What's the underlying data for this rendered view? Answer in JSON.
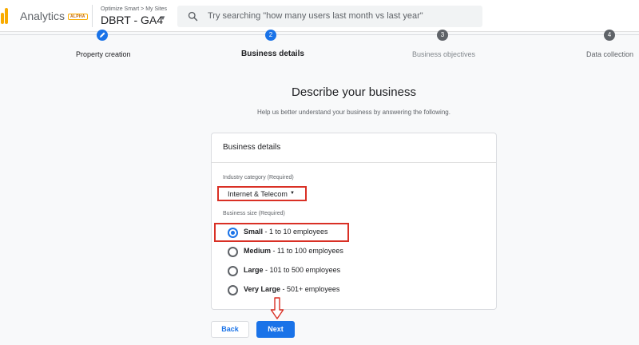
{
  "header": {
    "app_name": "Analytics",
    "badge": "ALPHA",
    "breadcrumb": "Optimize Smart > My Sites",
    "property": "DBRT - GA4",
    "search_placeholder": "Try searching \"how many users last month vs last year\"",
    "brand_color": "#f9ab00"
  },
  "steps": [
    {
      "number": "",
      "label": "Property creation",
      "state": "done"
    },
    {
      "number": "2",
      "label": "Business details",
      "state": "active"
    },
    {
      "number": "3",
      "label": "Business objectives",
      "state": "todo"
    },
    {
      "number": "4",
      "label": "Data collection",
      "state": "todo"
    }
  ],
  "page": {
    "title": "Describe your business",
    "subtitle": "Help us better understand your business by answering the following."
  },
  "card": {
    "title": "Business details",
    "industry_label": "Industry category (Required)",
    "industry_value": "Internet & Telecom",
    "size_label": "Business size (Required)",
    "size_options": [
      {
        "name": "Small",
        "detail": " - 1 to 10 employees",
        "checked": true
      },
      {
        "name": "Medium",
        "detail": " - 11 to 100 employees",
        "checked": false
      },
      {
        "name": "Large",
        "detail": " - 101 to 500 employees",
        "checked": false
      },
      {
        "name": "Very Large",
        "detail": " - 501+ employees",
        "checked": false
      }
    ]
  },
  "buttons": {
    "back": "Back",
    "next": "Next"
  },
  "colors": {
    "accent": "#1a73e8",
    "highlight": "#d93025"
  }
}
